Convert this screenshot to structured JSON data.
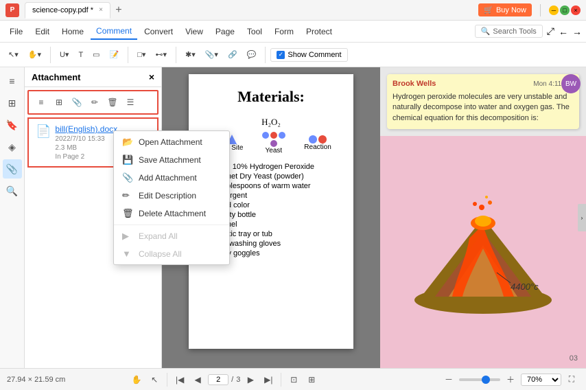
{
  "titlebar": {
    "logo": "P",
    "tab_label": "science-copy.pdf *",
    "tab_close": "×",
    "new_tab": "+",
    "buy_now": "Buy Now",
    "window_min": "─",
    "window_max": "□",
    "window_close": "×"
  },
  "menubar": {
    "items": [
      "File",
      "Edit",
      "Home",
      "Comment",
      "Convert",
      "View",
      "Page",
      "Tool",
      "Form",
      "Protect"
    ],
    "active": "Comment",
    "search_placeholder": "Search Tools",
    "expand": "⤢",
    "back": "←",
    "forward": "→"
  },
  "toolbar": {
    "groups": {
      "note": "⋯",
      "stamp": "⊞",
      "text_markup": "T",
      "shapes": "□",
      "measure": "⊷",
      "attachment": "📎",
      "link": "🔗",
      "comment_icons": "💬",
      "show_comment": "Show Comment"
    }
  },
  "sidebar": {
    "icons": [
      "≡",
      "🔖",
      "◈",
      "💬",
      "▶",
      "🔍"
    ]
  },
  "attachment_panel": {
    "title": "Attachment",
    "close": "×",
    "tools": [
      "≡",
      "⊞",
      "📎",
      "✏",
      "🗑",
      "☰"
    ],
    "file": {
      "name": "bill(English).docx",
      "date": "2022/7/10  15:33",
      "size": "2.3 MB",
      "page": "In Page 2"
    }
  },
  "context_menu": {
    "items": [
      {
        "label": "Open Attachment",
        "icon": "📂",
        "disabled": false
      },
      {
        "label": "Save Attachment",
        "icon": "💾",
        "disabled": false
      },
      {
        "label": "Add Attachment",
        "icon": "📎",
        "disabled": false
      },
      {
        "label": "Edit Description",
        "icon": "✏",
        "disabled": false
      },
      {
        "label": "Delete Attachment",
        "icon": "🗑",
        "disabled": false
      },
      {
        "separator": true
      },
      {
        "label": "Expand All",
        "icon": "▶",
        "disabled": true
      },
      {
        "label": "Collapse All",
        "icon": "▼",
        "disabled": true
      }
    ]
  },
  "pdf": {
    "title": "Materials:",
    "chemistry": {
      "formula": "H₂O₂",
      "labels": [
        "Active Site",
        "Yeast",
        "Reaction"
      ],
      "description": ""
    },
    "materials_list": [
      "25ml 10% Hydrogen Peroxide",
      "Sachet Dry Yeast (powder)",
      "4 tablespoons of warm water",
      "Detergent",
      "Food color",
      "Empty bottle",
      "Funnel",
      "Plastic tray or tub",
      "Dishwashing gloves",
      "Safty goggles"
    ]
  },
  "comment": {
    "author": "Brook Wells",
    "date": "Mon 4:11 PM",
    "text": "Hydrogen peroxide molecules are very unstable and naturally decompose into water and oxygen gas. The chemical equation for this decomposition is:",
    "avatar_initials": "BW"
  },
  "volcano": {
    "temp_label": "4400°c"
  },
  "bottombar": {
    "dimensions": "27.94 × 21.59 cm",
    "page_current": "2",
    "page_total": "3",
    "page_separator": "/",
    "zoom": "70%"
  }
}
